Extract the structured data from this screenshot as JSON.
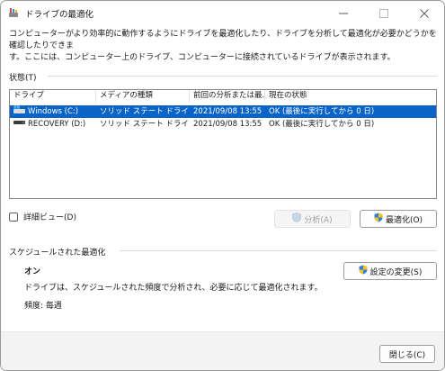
{
  "window": {
    "title": "ドライブの最適化"
  },
  "description": {
    "line1": "コンピューターがより効率的に動作するようにドライブを最適化したり、ドライブを分析して最適化が必要かどうかを確認したりできま",
    "line2": "す。ここには、コンピューター上のドライブ、コンピューターに接続されているドライブが表示されます。"
  },
  "status_section": {
    "label": "状態(T)"
  },
  "drive_list": {
    "columns": [
      "ドライブ",
      "メディアの種類",
      "前回の分析または最...",
      "現在の状態"
    ],
    "rows": [
      {
        "drive": "Windows (C:)",
        "media": "ソリッド ステート ドライブ",
        "last": "2021/09/08 13:55",
        "status": "OK (最後に実行してから 0 日)",
        "selected": true,
        "icon": "windows-drive-icon"
      },
      {
        "drive": "RECOVERY (D:)",
        "media": "ソリッド ステート ドライブ",
        "last": "2021/09/08 13:55",
        "status": "OK (最後に実行してから 0 日)",
        "selected": false,
        "icon": "drive-icon"
      }
    ]
  },
  "detail_view": {
    "label": "詳細ビュー(D)",
    "checked": false
  },
  "buttons": {
    "analyze": "分析(A)",
    "optimize": "最適化(O)",
    "change_settings": "設定の変更(S)",
    "close": "閉じる(C)"
  },
  "schedule_section": {
    "label": "スケジュールされた最適化",
    "status": "オン",
    "description": "ドライブは、スケジュールされた頻度で分析され、必要に応じて最適化されます。",
    "frequency": "頻度: 毎週"
  },
  "colors": {
    "selection": "#0a64c8",
    "accent": "#0a64c8"
  }
}
